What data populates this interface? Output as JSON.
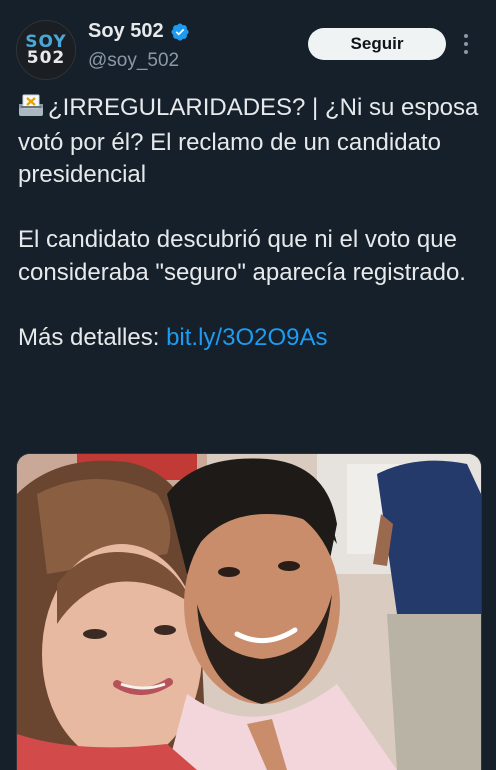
{
  "account": {
    "avatar_line1": "SOY",
    "avatar_line2": "502",
    "display_name": "Soy 502",
    "handle": "@soy_502",
    "verified": true
  },
  "actions": {
    "follow_label": "Seguir",
    "more_icon": "more-vertical-icon"
  },
  "tweet": {
    "emoji_icon": "ballot-box-icon",
    "paragraph1": "¿IRREGULARIDADES? | ¿Ni su esposa votó por él? El reclamo de un candidato presidencial",
    "paragraph2": "El candidato descubrió que ni el voto que consideraba \"seguro\" aparecía registrado.",
    "paragraph3_prefix": "Más detalles: ",
    "link_text": "bit.ly/3O2O9As"
  },
  "colors": {
    "background": "#15202b",
    "text": "#e7e9ea",
    "secondary": "#8b98a5",
    "link": "#1d9bf0",
    "verified": "#1d9bf0",
    "follow_bg": "#eff3f4"
  }
}
